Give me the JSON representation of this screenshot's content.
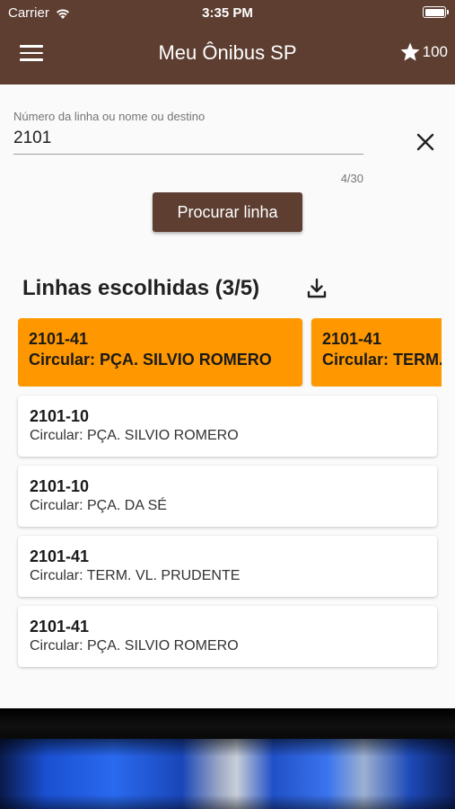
{
  "status_bar": {
    "carrier": "Carrier",
    "time": "3:35 PM"
  },
  "app_bar": {
    "title": "Meu Ônibus SP",
    "favorites_count": "100"
  },
  "search": {
    "label": "Número da linha ou nome ou destino",
    "value": "2101",
    "counter": "4/30",
    "button_label": "Procurar linha"
  },
  "chosen_section": {
    "title": "Linhas escolhidas (3/5)",
    "cards": [
      {
        "number": "2101-41",
        "destination": "Circular: PÇA. SILVIO ROMERO"
      },
      {
        "number": "2101-41",
        "destination": "Circular: TERM. VL. PRUDENTE"
      }
    ]
  },
  "results": [
    {
      "number": "2101-10",
      "destination": "Circular: PÇA. SILVIO ROMERO"
    },
    {
      "number": "2101-10",
      "destination": "Circular: PÇA. DA SÉ"
    },
    {
      "number": "2101-41",
      "destination": "Circular: TERM. VL. PRUDENTE"
    },
    {
      "number": "2101-41",
      "destination": "Circular: PÇA. SILVIO ROMERO"
    }
  ],
  "colors": {
    "brand": "#5d3e31",
    "chosen": "#ff9800",
    "background": "#fafafa"
  },
  "icons": [
    "wifi-icon",
    "battery-icon",
    "menu-icon",
    "star-icon",
    "close-icon",
    "download-icon"
  ]
}
